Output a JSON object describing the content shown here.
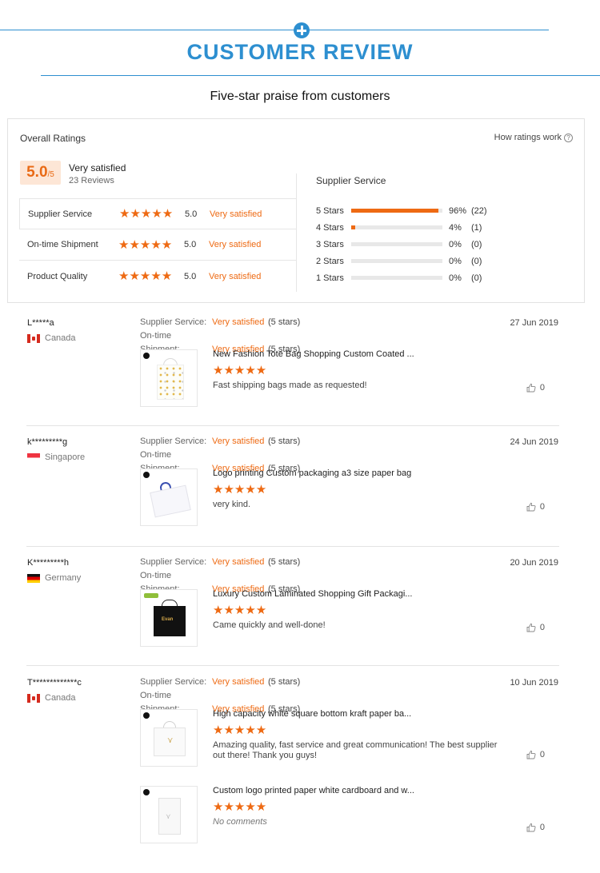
{
  "header": {
    "title": "CUSTOMER REVIEW",
    "subtitle": "Five-star praise from customers"
  },
  "summary": {
    "title": "Overall Ratings",
    "how_link": "How ratings work",
    "score": "5.0",
    "score_max": "/5",
    "score_label": "Very satisfied",
    "review_count": "23 Reviews",
    "stars_glyph": "★★★★★",
    "ratings": [
      {
        "name": "Supplier Service",
        "value": "5.0",
        "label": "Very satisfied"
      },
      {
        "name": "On-time Shipment",
        "value": "5.0",
        "label": "Very satisfied"
      },
      {
        "name": "Product Quality",
        "value": "5.0",
        "label": "Very satisfied"
      }
    ],
    "distribution_title": "Supplier Service",
    "distribution": [
      {
        "label": "5 Stars",
        "pct": "96%",
        "count": "(22)",
        "fraction": 0.96
      },
      {
        "label": "4 Stars",
        "pct": "4%",
        "count": "(1)",
        "fraction": 0.04
      },
      {
        "label": "3 Stars",
        "pct": "0%",
        "count": "(0)",
        "fraction": 0
      },
      {
        "label": "2 Stars",
        "pct": "0%",
        "count": "(0)",
        "fraction": 0
      },
      {
        "label": "1 Stars",
        "pct": "0%",
        "count": "(0)",
        "fraction": 0
      }
    ]
  },
  "colors": {
    "accent": "#2d8fd0",
    "star": "#ee6a13"
  },
  "review_labels": {
    "supplier_key": "Supplier Service:",
    "shipment_key": "On-time Shipment:",
    "value": "Very satisfied",
    "stars": "(5 stars)"
  },
  "reviews": [
    {
      "user": "L*****a",
      "country": "Canada",
      "flag": "canada",
      "date": "27 Jun 2019",
      "items": [
        {
          "title": "New Fashion Tote Bag Shopping Custom Coated ...",
          "comment": "Fast shipping bags made as requested!",
          "likes": "0",
          "image": "dotted-tote-bag"
        }
      ]
    },
    {
      "user": "k*********g",
      "country": "Singapore",
      "flag": "singapore",
      "date": "24 Jun 2019",
      "items": [
        {
          "title": "Logo printing Custom packaging a3 size paper bag",
          "comment": "very kind.",
          "likes": "0",
          "image": "white-paper-bag"
        }
      ]
    },
    {
      "user": "K*********h",
      "country": "Germany",
      "flag": "germany",
      "date": "20 Jun 2019",
      "items": [
        {
          "title": "Luxury Custom Laminated Shopping Gift Packagi...",
          "comment": "Came quickly and well-done!",
          "likes": "0",
          "image": "black-gift-bag",
          "image_text": "Evan"
        }
      ]
    },
    {
      "user": "T*************c",
      "country": "Canada",
      "flag": "canada",
      "date": "10 Jun 2019",
      "items": [
        {
          "title": "High capacity white square bottom kraft paper ba...",
          "comment": "Amazing quality, fast service and great communication! The best supplier out there! Thank you guys!",
          "likes": "0",
          "image": "white-square-bag"
        },
        {
          "title": "Custom logo printed paper white cardboard and w...",
          "comment": "No comments",
          "likes": "0",
          "image": "white-tall-bag"
        }
      ]
    }
  ]
}
